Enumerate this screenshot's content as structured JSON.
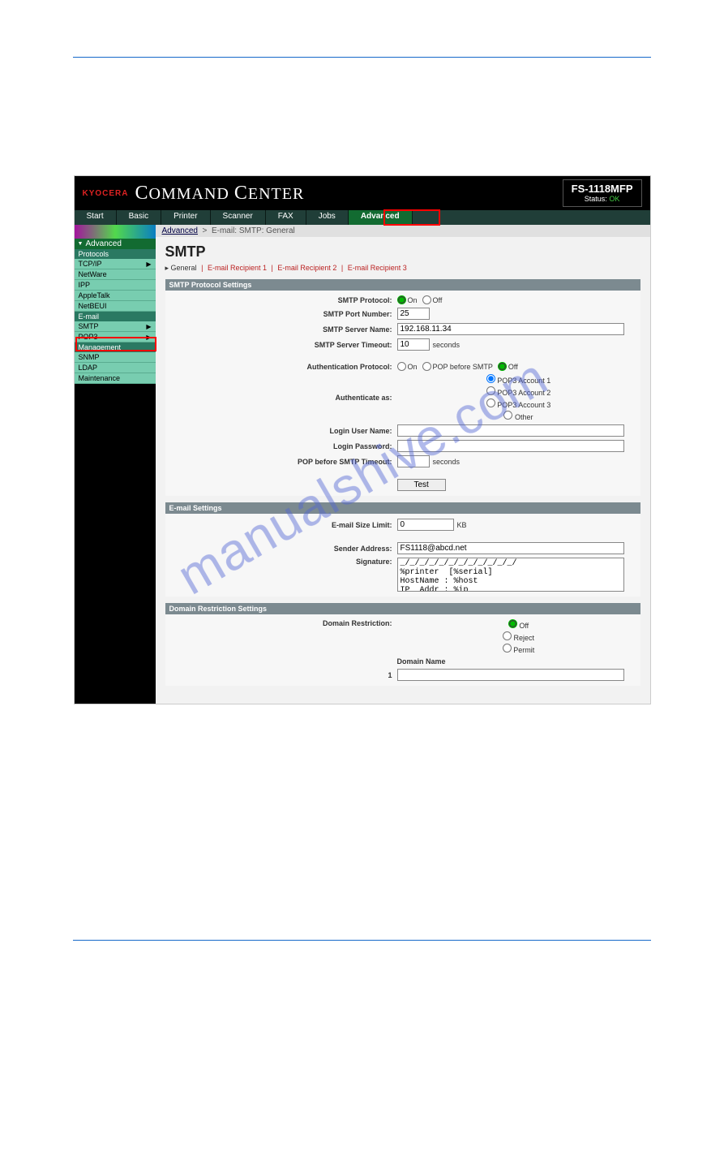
{
  "watermark": "manualshive.com",
  "brand": {
    "logo": "KYOCERA",
    "name_a": "C",
    "name_b": "OMMAND ",
    "name_c": "C",
    "name_d": "ENTER"
  },
  "status": {
    "model": "FS-1118MFP",
    "label": "Status:",
    "value": "OK"
  },
  "tabs": [
    "Start",
    "Basic",
    "Printer",
    "Scanner",
    "FAX",
    "Jobs",
    "Advanced"
  ],
  "breadcrumb": {
    "root": "Advanced",
    "sep": ">",
    "page": "E-mail: SMTP: General"
  },
  "sidebar": {
    "header": "Advanced",
    "sections": [
      {
        "title": "Protocols",
        "items": [
          {
            "label": "TCP/IP",
            "arrow": true
          },
          {
            "label": "NetWare"
          },
          {
            "label": "IPP"
          },
          {
            "label": "AppleTalk"
          },
          {
            "label": "NetBEUI"
          }
        ]
      },
      {
        "title": "E-mail",
        "items": [
          {
            "label": "SMTP",
            "arrow": true
          },
          {
            "label": "POP3",
            "arrow": true
          }
        ]
      },
      {
        "title": "Management",
        "items": [
          {
            "label": "SNMP"
          },
          {
            "label": "LDAP"
          },
          {
            "label": "Maintenance"
          }
        ]
      }
    ]
  },
  "page": {
    "title": "SMTP",
    "subtabs": {
      "current": "General",
      "items": [
        "E-mail Recipient 1",
        "E-mail Recipient 2",
        "E-mail Recipient 3"
      ],
      "sep": "|",
      "bullet": "▸ "
    }
  },
  "sec1": {
    "title": "SMTP Protocol Settings",
    "protocol": {
      "label": "SMTP Protocol:",
      "on": "On",
      "off": "Off"
    },
    "port": {
      "label": "SMTP Port Number:",
      "value": "25"
    },
    "server": {
      "label": "SMTP Server Name:",
      "value": "192.168.11.34"
    },
    "timeout": {
      "label": "SMTP Server Timeout:",
      "value": "10",
      "unit": "seconds"
    },
    "auth": {
      "label": "Authentication Protocol:",
      "on": "On",
      "pop": "POP before SMTP",
      "off": "Off"
    },
    "authas": {
      "label": "Authenticate as:",
      "opts": [
        "POP3 Account 1",
        "POP3 Account 2",
        "POP3 Account 3",
        "Other"
      ]
    },
    "user": {
      "label": "Login User Name:",
      "value": ""
    },
    "pass": {
      "label": "Login Password:",
      "value": ""
    },
    "poptimeout": {
      "label": "POP before SMTP Timeout:",
      "value": "",
      "unit": "seconds"
    },
    "test": "Test"
  },
  "sec2": {
    "title": "E-mail Settings",
    "size": {
      "label": "E-mail Size Limit:",
      "value": "0",
      "unit": "KB"
    },
    "sender": {
      "label": "Sender Address:",
      "value": "FS1118@abcd.net"
    },
    "sig": {
      "label": "Signature:",
      "value": "_/_/_/_/_/_/_/_/_/_/_/_/\n%printer  [%serial]\nHostName : %host\nIP  Addr : %ip\n_/_/_/_/_/_/_/_/_/_/_/_/"
    }
  },
  "sec3": {
    "title": "Domain Restriction Settings",
    "restrict": {
      "label": "Domain Restriction:",
      "off": "Off",
      "reject": "Reject",
      "permit": "Permit"
    },
    "domain": {
      "header": "Domain Name",
      "n": "1",
      "value": ""
    }
  }
}
